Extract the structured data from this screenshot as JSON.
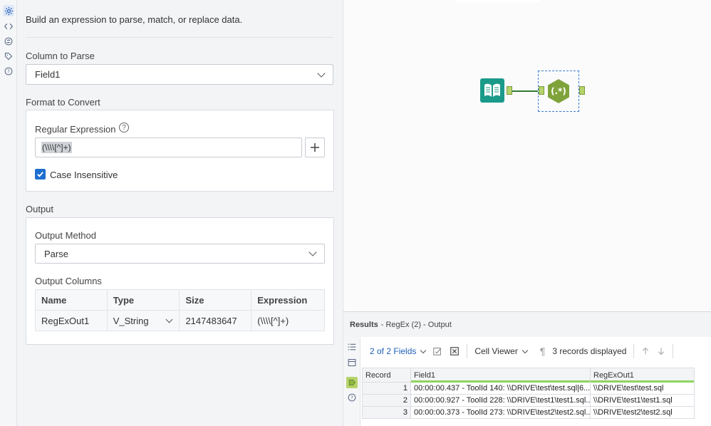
{
  "description": "Build an expression to parse, match, or replace data.",
  "column_to_parse": {
    "label": "Column to Parse",
    "value": "Field1"
  },
  "format_to_convert": {
    "label": "Format to Convert",
    "regex_label": "Regular Expression",
    "regex_value": "(\\\\\\\\[^]+)",
    "case_insensitive_label": "Case Insensitive",
    "case_insensitive": true
  },
  "output": {
    "label": "Output",
    "method_label": "Output Method",
    "method_value": "Parse",
    "columns_label": "Output Columns",
    "headers": [
      "Name",
      "Type",
      "Size",
      "Expression"
    ],
    "rows": [
      {
        "name": "RegExOut1",
        "type": "V_String",
        "size": "2147483647",
        "expression": "(\\\\\\\\[^]+)"
      }
    ]
  },
  "results": {
    "title": "Results",
    "subtitle": "- RegEx (2) - Output",
    "fields_label": "2 of 2 Fields",
    "cell_viewer_label": "Cell Viewer",
    "records_displayed": "3 records displayed",
    "headers": [
      "Record",
      "Field1",
      "RegExOut1"
    ],
    "rows": [
      {
        "record": "1",
        "field1": "00:00:00.437 - ToolId 140: \\\\DRIVE\\test\\test.sql|6...",
        "out": "\\\\DRIVE\\test\\test.sql"
      },
      {
        "record": "2",
        "field1": "00:00:00.927 - ToolId 228: \\\\DRIVE\\test1\\test1.sql...",
        "out": "\\\\DRIVE\\test1\\test1.sql"
      },
      {
        "record": "3",
        "field1": "00:00:00.373 - ToolId 273: \\\\DRIVE\\test2\\test2.sql...",
        "out": "\\\\DRIVE\\test2\\test2.sql"
      }
    ]
  },
  "canvas": {
    "regex_tool_glyph": "(.*)"
  },
  "colors": {
    "accent": "#1f6fd0",
    "input_tool": "#1b9a8a",
    "regex_tool": "#7fa33a",
    "anchor": "#b6d46b"
  }
}
